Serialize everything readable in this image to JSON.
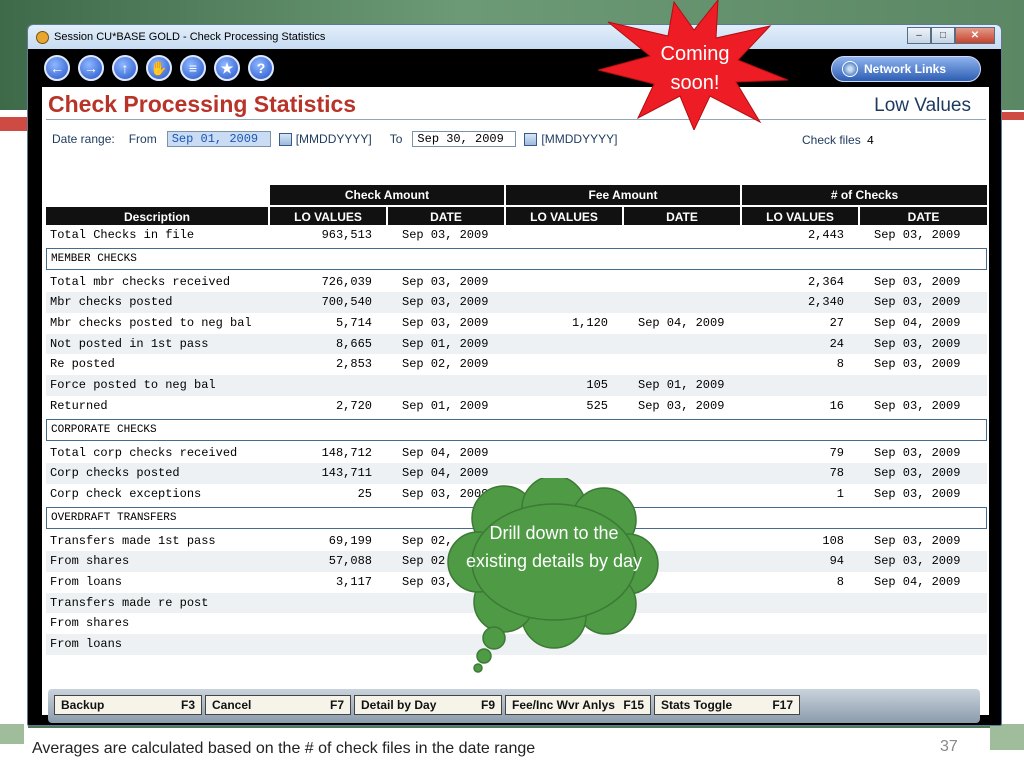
{
  "window": {
    "title": "Session  CU*BASE GOLD - Check Processing Statistics"
  },
  "toolbar": {
    "icons": [
      "back-icon",
      "forward-icon",
      "up-icon",
      "hand-icon",
      "print-icon",
      "star-icon",
      "help-icon"
    ],
    "network_links": "Network Links"
  },
  "page": {
    "heading": "Check Processing Statistics",
    "mode": "Low Values"
  },
  "date_range": {
    "label": "Date range:",
    "from_label": "From",
    "from_value": "Sep 01, 2009",
    "from_format": "[MMDDYYYY]",
    "to_label": "To",
    "to_value": "Sep 30, 2009",
    "to_format": "[MMDDYYYY]"
  },
  "check_files": {
    "label": "Check files",
    "value": "4"
  },
  "table": {
    "groups": [
      "Check Amount",
      "Fee Amount",
      "# of Checks"
    ],
    "columns": [
      "Description",
      "LO VALUES",
      "DATE",
      "LO VALUES",
      "DATE",
      "LO VALUES",
      "DATE"
    ],
    "rows": [
      {
        "d": "Total Checks in file",
        "a": "963,513",
        "ad": "Sep 03, 2009",
        "f": "",
        "fd": "",
        "n": "2,443",
        "nd": "Sep 03, 2009"
      },
      {
        "section": "MEMBER CHECKS"
      },
      {
        "d": "Total mbr checks received",
        "a": "726,039",
        "ad": "Sep 03, 2009",
        "f": "",
        "fd": "",
        "n": "2,364",
        "nd": "Sep 03, 2009"
      },
      {
        "d": "Mbr checks posted",
        "a": "700,540",
        "ad": "Sep 03, 2009",
        "f": "",
        "fd": "",
        "n": "2,340",
        "nd": "Sep 03, 2009"
      },
      {
        "d": "Mbr checks posted to neg bal",
        "a": "5,714",
        "ad": "Sep 03, 2009",
        "f": "1,120",
        "fd": "Sep 04, 2009",
        "n": "27",
        "nd": "Sep 04, 2009"
      },
      {
        "d": "Not posted in 1st pass",
        "a": "8,665",
        "ad": "Sep 01, 2009",
        "f": "",
        "fd": "",
        "n": "24",
        "nd": "Sep 03, 2009"
      },
      {
        "d": "Re posted",
        "a": "2,853",
        "ad": "Sep 02, 2009",
        "f": "",
        "fd": "",
        "n": "8",
        "nd": "Sep 03, 2009"
      },
      {
        "d": "Force posted to neg bal",
        "a": "",
        "ad": "",
        "f": "105",
        "fd": "Sep 01, 2009",
        "n": "",
        "nd": ""
      },
      {
        "d": "Returned",
        "a": "2,720",
        "ad": "Sep 01, 2009",
        "f": "525",
        "fd": "Sep 03, 2009",
        "n": "16",
        "nd": "Sep 03, 2009"
      },
      {
        "section": "CORPORATE CHECKS"
      },
      {
        "d": "Total corp checks received",
        "a": "148,712",
        "ad": "Sep 04, 2009",
        "f": "",
        "fd": "",
        "n": "79",
        "nd": "Sep 03, 2009"
      },
      {
        "d": "Corp checks posted",
        "a": "143,711",
        "ad": "Sep 04, 2009",
        "f": "",
        "fd": "",
        "n": "78",
        "nd": "Sep 03, 2009"
      },
      {
        "d": "Corp check exceptions",
        "a": "25",
        "ad": "Sep 03, 2009",
        "f": "",
        "fd": "",
        "n": "1",
        "nd": "Sep 03, 2009"
      },
      {
        "section": "OVERDRAFT TRANSFERS"
      },
      {
        "d": "Transfers made 1st pass",
        "a": "69,199",
        "ad": "Sep 02,",
        "f": "",
        "fd": "",
        "n": "108",
        "nd": "Sep 03, 2009"
      },
      {
        "d": "From shares",
        "a": "57,088",
        "ad": "Sep 02",
        "f": "",
        "fd": "",
        "n": "94",
        "nd": "Sep 03, 2009"
      },
      {
        "d": "From loans",
        "a": "3,117",
        "ad": "Sep 03,",
        "f": "",
        "fd": "",
        "n": "8",
        "nd": "Sep 04, 2009"
      },
      {
        "d": "Transfers made re post",
        "a": "",
        "ad": "",
        "f": "",
        "fd": "",
        "n": "",
        "nd": ""
      },
      {
        "d": "From shares",
        "a": "",
        "ad": "",
        "f": "",
        "fd": "",
        "n": "",
        "nd": ""
      },
      {
        "d": "From loans",
        "a": "",
        "ad": "",
        "f": "",
        "fd": "",
        "n": "",
        "nd": ""
      }
    ]
  },
  "fkeys": [
    {
      "label": "Backup",
      "key": "F3"
    },
    {
      "label": "Cancel",
      "key": "F7"
    },
    {
      "label": "Detail by Day",
      "key": "F9"
    },
    {
      "label": "Fee/Inc Wvr Anlys",
      "key": "F15"
    },
    {
      "label": "Stats Toggle",
      "key": "F17"
    }
  ],
  "callouts": {
    "star": "Coming soon!",
    "cloud": "Drill down to the existing details by day"
  },
  "slide": {
    "footer": "Averages are calculated based on the # of check files in the date range",
    "page_number": "37"
  },
  "colors": {
    "heading": "#b83328",
    "star": "#ee1c25",
    "cloud": "#4e9a45"
  }
}
